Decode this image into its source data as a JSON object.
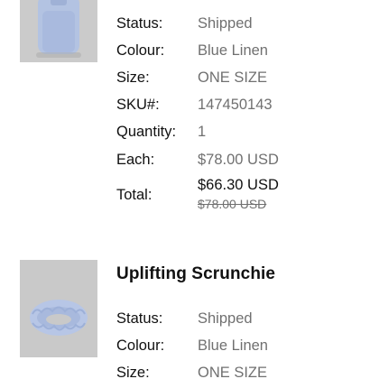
{
  "items": [
    {
      "image_alt": "Blue backpack product image",
      "fields": {
        "status_label": "Status:",
        "status_value": "Shipped",
        "colour_label": "Colour:",
        "colour_value": "Blue Linen",
        "size_label": "Size:",
        "size_value": "ONE SIZE",
        "sku_label": "SKU#:",
        "sku_value": "147450143",
        "quantity_label": "Quantity:",
        "quantity_value": "1",
        "each_label": "Each:",
        "each_value": "$78.00 USD",
        "total_label": "Total:",
        "total_value": "$66.30 USD",
        "original_total_value": "$78.00 USD"
      }
    },
    {
      "name": "Uplifting Scrunchie",
      "image_alt": "Blue scrunchie product image",
      "fields": {
        "status_label": "Status:",
        "status_value": "Shipped",
        "colour_label": "Colour:",
        "colour_value": "Blue Linen",
        "size_label": "Size:",
        "size_value": "ONE SIZE"
      }
    }
  ],
  "colors": {
    "label_text": "#111111",
    "value_text": "#707070",
    "product_blue": "#b9c8e6"
  }
}
